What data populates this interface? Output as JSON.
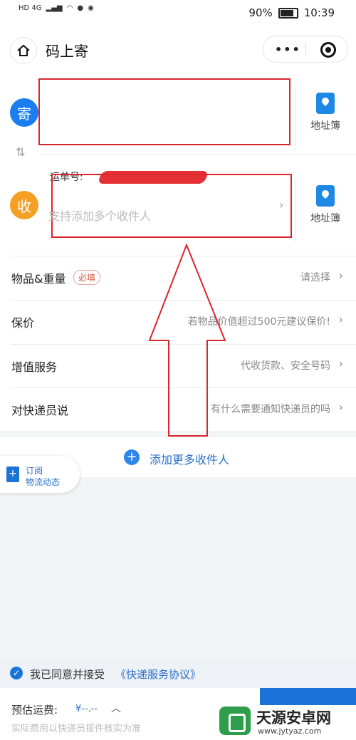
{
  "statusbar": {
    "left_icons": "HD 4G",
    "battery": "90%",
    "time": "10:39",
    "battery_level": 0.9
  },
  "nav": {
    "title": "码上寄"
  },
  "sender": {
    "circle": "寄",
    "address_book": "地址簿"
  },
  "receiver": {
    "circle": "收",
    "address_book": "地址簿",
    "waybill_label": "运单号:",
    "placeholder": "支持添加多个收件人"
  },
  "rows": [
    {
      "label": "物品&重量",
      "badge": "必填",
      "value": "请选择"
    },
    {
      "label": "保价",
      "value": "若物品价值超过500元建议保价!"
    },
    {
      "label": "增值服务",
      "value": "代收货款、安全号码"
    },
    {
      "label": "对快递员说",
      "value": "有什么需要通知快递员的吗"
    }
  ],
  "add_more": {
    "plus": "+",
    "label": "添加更多收件人"
  },
  "subscribe": {
    "line1": "订阅",
    "line2": "物流动态"
  },
  "agreement": {
    "prefix": "我已同意并接受",
    "link": "《快递服务协议》"
  },
  "footer": {
    "label": "预估运费:",
    "price": "¥--.--",
    "note": "实际费用以快递员揽件核实为准"
  },
  "watermark": {
    "title": "天源安卓网",
    "url": "www.jytyaz.com"
  },
  "colors": {
    "primary": "#1a73d6",
    "send": "#1a7df0",
    "receive": "#f5a024",
    "annotation": "#d9252c"
  }
}
